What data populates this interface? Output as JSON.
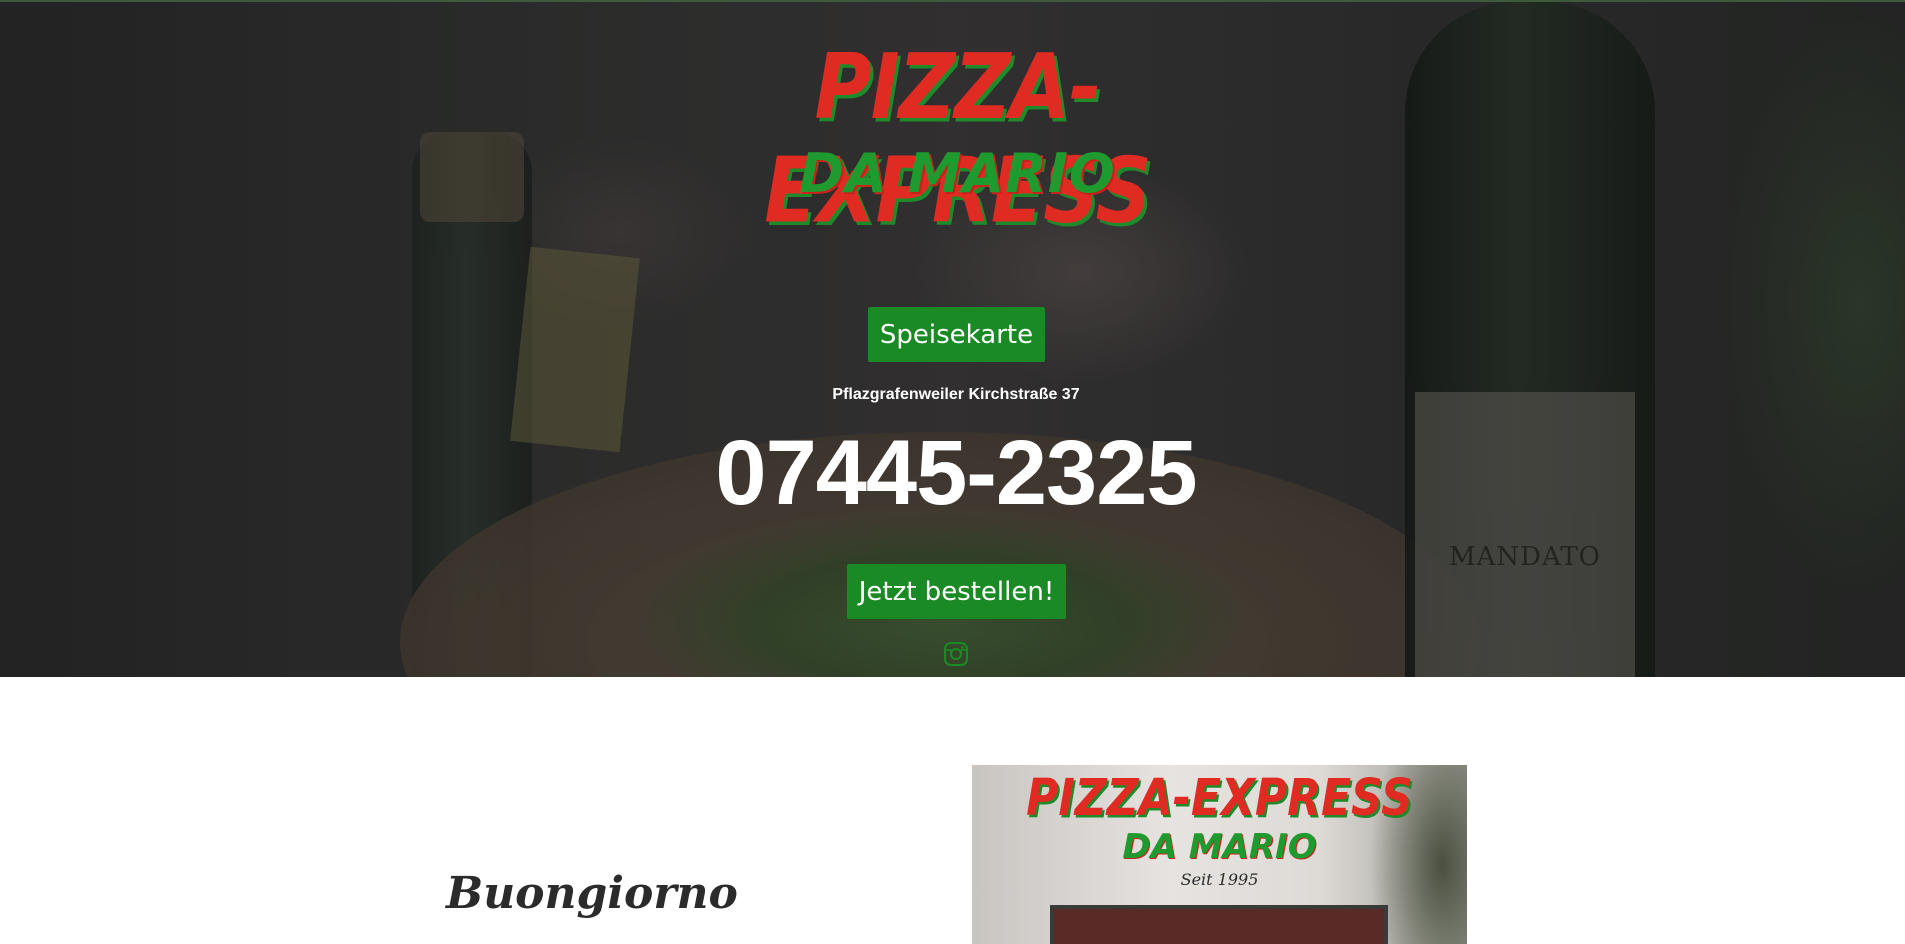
{
  "hero": {
    "logo_line1": "PIZZA-EXPRESS",
    "logo_line2": "DA MARIO",
    "menu_button_label": "Speisekarte",
    "address": "Pflazgrafenweiler Kirchstraße 37",
    "phone": "07445-2325",
    "order_button_label": "Jetzt bestellen!",
    "social_icon": "instagram-icon",
    "background_wine_label": "MANDATO"
  },
  "content": {
    "greeting": "Buongiorno",
    "promo_logo_line1": "PIZZA-EXPRESS",
    "promo_logo_line2": "DA MARIO",
    "promo_since": "Seit 1995"
  },
  "colors": {
    "brand_red": "#e02b23",
    "brand_green": "#1a8a24"
  }
}
